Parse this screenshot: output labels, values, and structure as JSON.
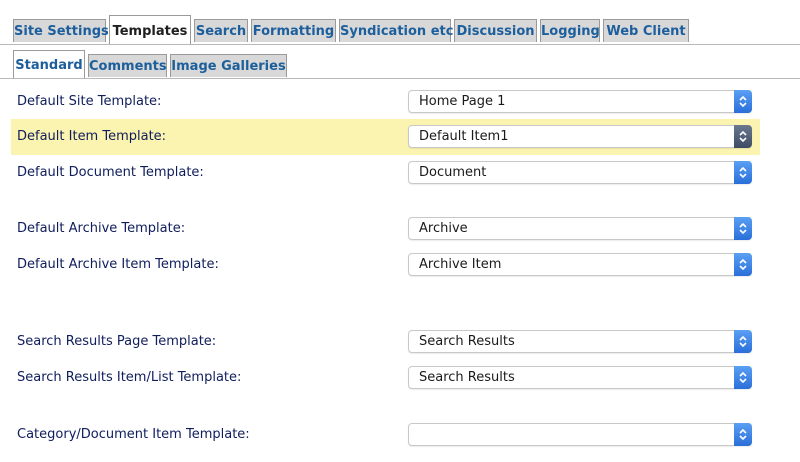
{
  "main_tabs": [
    {
      "label": "Site Settings"
    },
    {
      "label": "Templates"
    },
    {
      "label": "Search"
    },
    {
      "label": "Formatting"
    },
    {
      "label": "Syndication etc"
    },
    {
      "label": "Discussion"
    },
    {
      "label": "Logging"
    },
    {
      "label": "Web Client"
    }
  ],
  "active_main_tab": "Templates",
  "sub_tabs": [
    {
      "label": "Standard"
    },
    {
      "label": "Comments"
    },
    {
      "label": "Image Galleries"
    }
  ],
  "active_sub_tab": "Standard",
  "fields": [
    {
      "label": "Default Site Template:",
      "value": "Home Page 1"
    },
    {
      "label": "Default Item Template:",
      "value": "Default Item1"
    },
    {
      "label": "Default Document Template:",
      "value": "Document"
    },
    {
      "label": "Default Archive Template:",
      "value": "Archive"
    },
    {
      "label": "Default Archive Item Template:",
      "value": "Archive Item"
    },
    {
      "label": "Search Results Page Template:",
      "value": "Search Results"
    },
    {
      "label": "Search Results Item/List Template:",
      "value": "Search Results"
    },
    {
      "label": "Category/Document Item Template:",
      "value": ""
    }
  ],
  "colors": {
    "tab_text": "#1d5f9c",
    "label_text": "#0f1d5c",
    "highlight_row": "#fbf3b0",
    "select_arrow": "#2a6fd8"
  },
  "icons": {
    "select_arrows": "up-down-chevron-icon"
  }
}
